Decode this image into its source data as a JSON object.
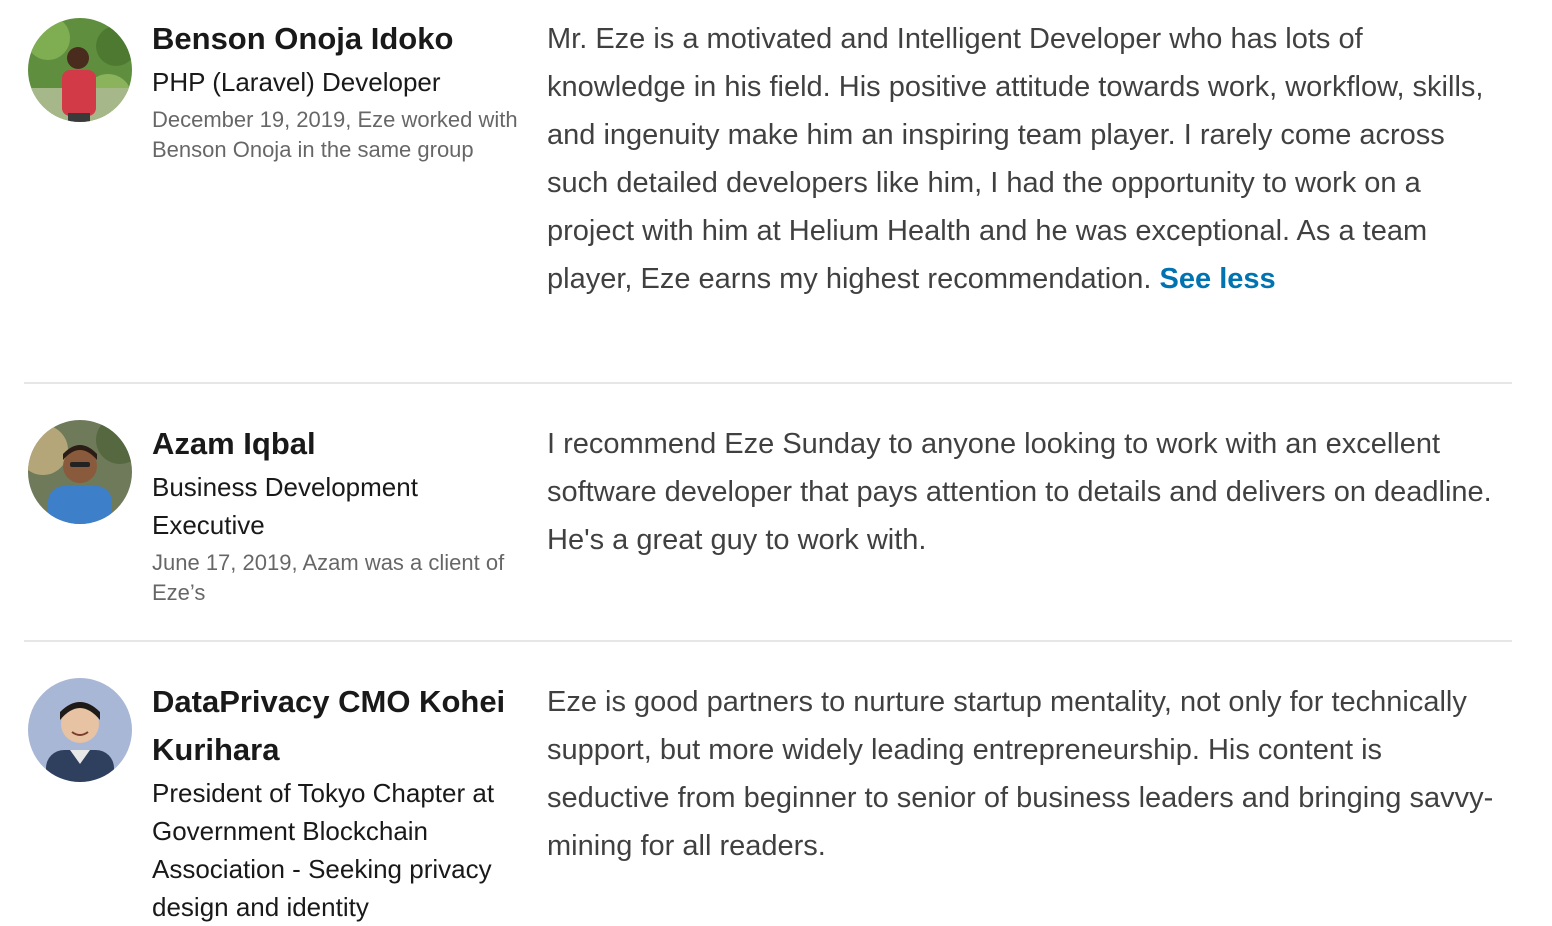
{
  "recommendations": [
    {
      "name": "Benson Onoja Idoko",
      "headline": "PHP (Laravel) Developer",
      "context": "December 19, 2019, Eze worked with Benson Onoja in the same group",
      "text": "Mr. Eze is a motivated and Intelligent Developer who has lots of knowledge in his field. His positive attitude towards work, workflow, skills, and ingenuity make him an inspiring team player. I rarely come across such detailed developers like him, I had the opportunity to work on a project with him at Helium Health and he was exceptional. As a team player, Eze earns my highest recommendation.",
      "toggle_label": "See less",
      "avatar_icon": "person-photo-icon"
    },
    {
      "name": "Azam Iqbal",
      "headline": "Business Development Executive",
      "context": "June 17, 2019, Azam was a client of Eze’s",
      "text": "I recommend Eze Sunday to anyone looking to work with an excellent software developer that pays attention to details and delivers on deadline. He's a great guy to work with.",
      "avatar_icon": "person-photo-icon"
    },
    {
      "name": "DataPrivacy CMO Kohei Kurihara",
      "headline": "President of Tokyo Chapter at Government Blockchain Association - Seeking privacy design and identity",
      "text": "Eze is good partners to nurture startup mentality, not only for technically support, but more widely leading entrepreneurship. His content is seductive from beginner to senior of business leaders and bringing savvy-mining for all readers.",
      "avatar_icon": "person-photo-icon"
    }
  ],
  "colors": {
    "link": "#0073b1",
    "divider": "#e6e6e6",
    "secondary_text": "rgba(0,0,0,0.6)"
  }
}
